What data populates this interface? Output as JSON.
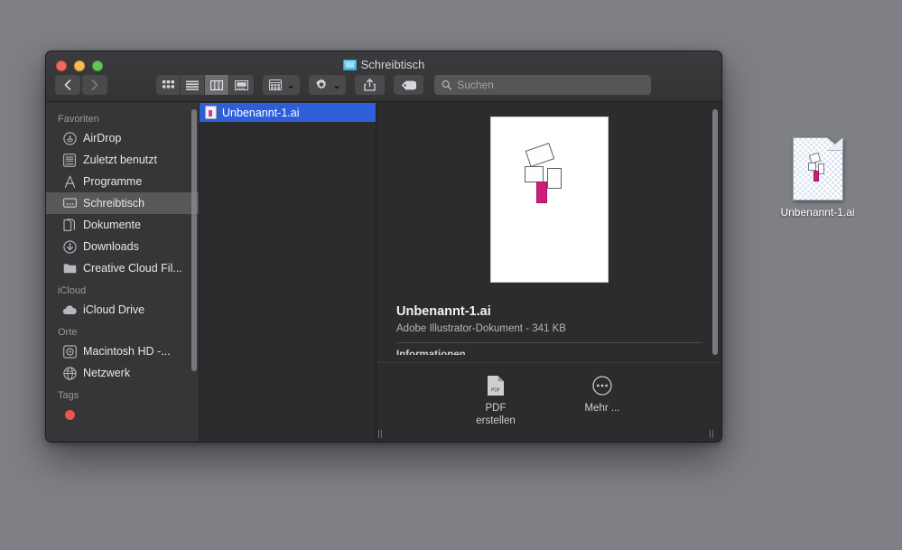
{
  "desktop": {
    "background_color": "#7e8085",
    "icon": {
      "label": "Unbenannt-1.ai",
      "icon_name": "illustrator-document-icon"
    }
  },
  "window": {
    "title": "Schreibtisch",
    "title_icon": "folder-icon",
    "traffic_lights": [
      {
        "name": "close",
        "color": "#ec6a5e"
      },
      {
        "name": "minimize",
        "color": "#f4bd4f"
      },
      {
        "name": "zoom",
        "color": "#61c554"
      }
    ],
    "toolbar": {
      "back_label": "‹",
      "forward_label": "›",
      "view_modes": [
        {
          "name": "icon-view",
          "active": false
        },
        {
          "name": "list-view",
          "active": false
        },
        {
          "name": "column-view",
          "active": true
        },
        {
          "name": "gallery-view",
          "active": false
        }
      ],
      "group_button": {
        "name": "arrange-button",
        "chevron": "⌄"
      },
      "action_button": {
        "name": "action-gear-button",
        "chevron": "⌄"
      },
      "share_button": {
        "name": "share-button"
      },
      "tag_button": {
        "name": "tag-button"
      },
      "search": {
        "placeholder": "Suchen",
        "value": ""
      }
    }
  },
  "sidebar": {
    "sections": [
      {
        "header": "Favoriten",
        "items": [
          {
            "label": "AirDrop",
            "icon": "airdrop-icon",
            "selected": false
          },
          {
            "label": "Zuletzt benutzt",
            "icon": "recents-icon",
            "selected": false
          },
          {
            "label": "Programme",
            "icon": "applications-icon",
            "selected": false
          },
          {
            "label": "Schreibtisch",
            "icon": "desktop-icon",
            "selected": true
          },
          {
            "label": "Dokumente",
            "icon": "documents-icon",
            "selected": false
          },
          {
            "label": "Downloads",
            "icon": "downloads-icon",
            "selected": false
          },
          {
            "label": "Creative Cloud Fil...",
            "icon": "folder-icon",
            "selected": false
          }
        ]
      },
      {
        "header": "iCloud",
        "items": [
          {
            "label": "iCloud Drive",
            "icon": "cloud-icon",
            "selected": false
          }
        ]
      },
      {
        "header": "Orte",
        "items": [
          {
            "label": "Macintosh HD -...",
            "icon": "harddisk-icon",
            "selected": false
          },
          {
            "label": "Netzwerk",
            "icon": "network-globe-icon",
            "selected": false
          }
        ]
      },
      {
        "header": "Tags",
        "items": [
          {
            "label": "",
            "icon": "red-tag-dot",
            "selected": false
          }
        ]
      }
    ]
  },
  "file_column": {
    "rows": [
      {
        "name": "Unbenannt-1.ai",
        "icon": "illustrator-file-icon",
        "selected": true
      }
    ]
  },
  "preview": {
    "thumbnail_name": "illustrator-artboard-preview",
    "title": "Unbenannt-1.ai",
    "subtitle": "Adobe Illustrator-Dokument - 341 KB",
    "section_heading": "Informationen",
    "quick_actions": [
      {
        "label_line1": "PDF",
        "label_line2": "erstellen",
        "icon": "pdf-document-icon"
      },
      {
        "label_line1": "Mehr ...",
        "label_line2": "",
        "icon": "more-ellipsis-icon"
      }
    ]
  },
  "colors": {
    "selection_blue": "#2f5fd8",
    "magenta_shape": "#d01b7d",
    "window_bg": "#2c2c2e",
    "sidebar_bg": "#363638"
  }
}
